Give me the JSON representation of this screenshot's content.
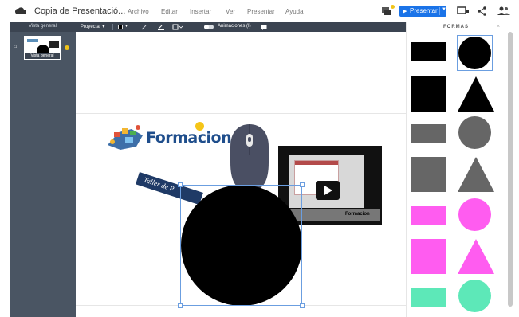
{
  "app": {
    "title": "Copia de Presentació..."
  },
  "menu": {
    "archivo": "Archivo",
    "editar": "Editar",
    "insertar": "Insertar",
    "ver": "Ver",
    "presentar": "Presentar",
    "ayuda": "Ayuda"
  },
  "header_actions": {
    "present_label": "Presentar",
    "notification_color": "#f0c419",
    "present_color": "#1a73e8"
  },
  "sidebar": {
    "title": "Vista general",
    "thumbnail_caption": "Vista general"
  },
  "toolbar": {
    "proyectar_label": "Proyectar ▾",
    "animations_label": "Animaciones (I)"
  },
  "slide": {
    "logo_text": "Formacion",
    "tag_text": "Taller de P",
    "laptop_caption": "Formacion"
  },
  "shapes_panel": {
    "title": "FORMAS",
    "close_glyph": "×",
    "colors": [
      "#000000",
      "#666666",
      "#ff5cf0",
      "#5de8b8"
    ],
    "selection_color": "#6b9ee0"
  }
}
